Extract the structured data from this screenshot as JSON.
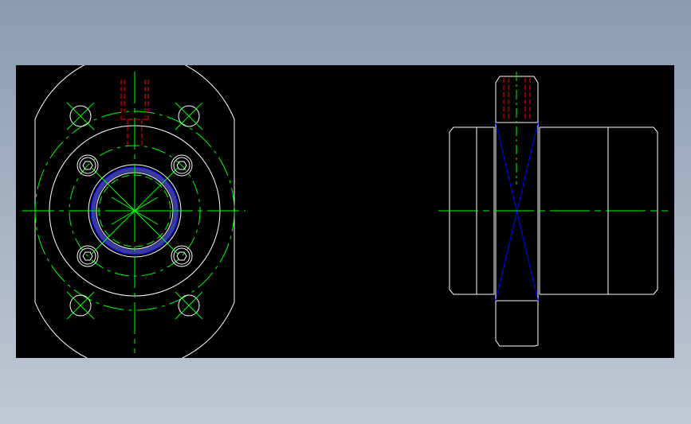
{
  "drawing": {
    "background": "#000000",
    "colors": {
      "outline": "#ffffff",
      "centerline": "#00ff00",
      "hidden": "#ff0000",
      "accent": "#0000ff",
      "ring_fill": "#3a3aa0"
    },
    "views": [
      "front-view",
      "side-view"
    ]
  }
}
